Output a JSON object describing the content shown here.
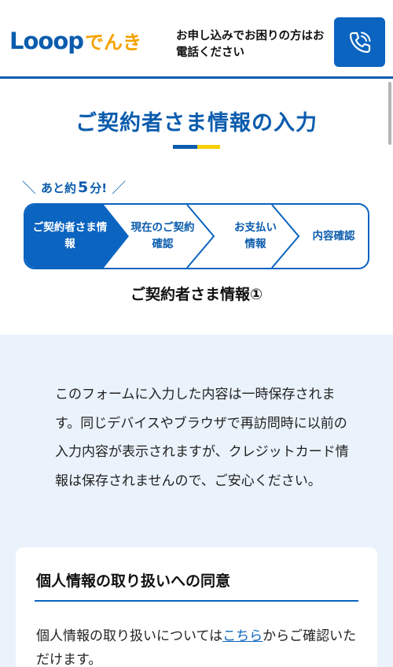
{
  "header": {
    "logo_main": "Looop",
    "logo_sub": "でんき",
    "message": "お申し込みでお困りの方はお電話ください",
    "phone_icon": "phone-icon"
  },
  "page": {
    "title": "ご契約者さま情報の入力"
  },
  "time_hint": {
    "prefix": "あと約",
    "number": "5",
    "suffix": "分!"
  },
  "steps": [
    {
      "label": "ご契約者さま情報",
      "active": true
    },
    {
      "label": "現在のご契約確認",
      "active": false
    },
    {
      "label": "お支払い情報",
      "active": false
    },
    {
      "label": "内容確認",
      "active": false
    }
  ],
  "step_heading": "ご契約者さま情報①",
  "notice": "このフォームに入力した内容は一時保存されます。同じデバイスやブラウザで再訪問時に以前の入力内容が表示されますが、クレジットカード情報は保存されませんので、ご安心ください。",
  "consent": {
    "title": "個人情報の取り扱いへの同意",
    "text_before": "個人情報の取り扱いについては",
    "link": "こちら",
    "text_after": "からご確認いただけます。"
  },
  "colors": {
    "brand_blue": "#0b5cad",
    "brand_orange": "#f5a200",
    "accent_yellow": "#f5d000",
    "light_bg": "#eaf3fc"
  }
}
